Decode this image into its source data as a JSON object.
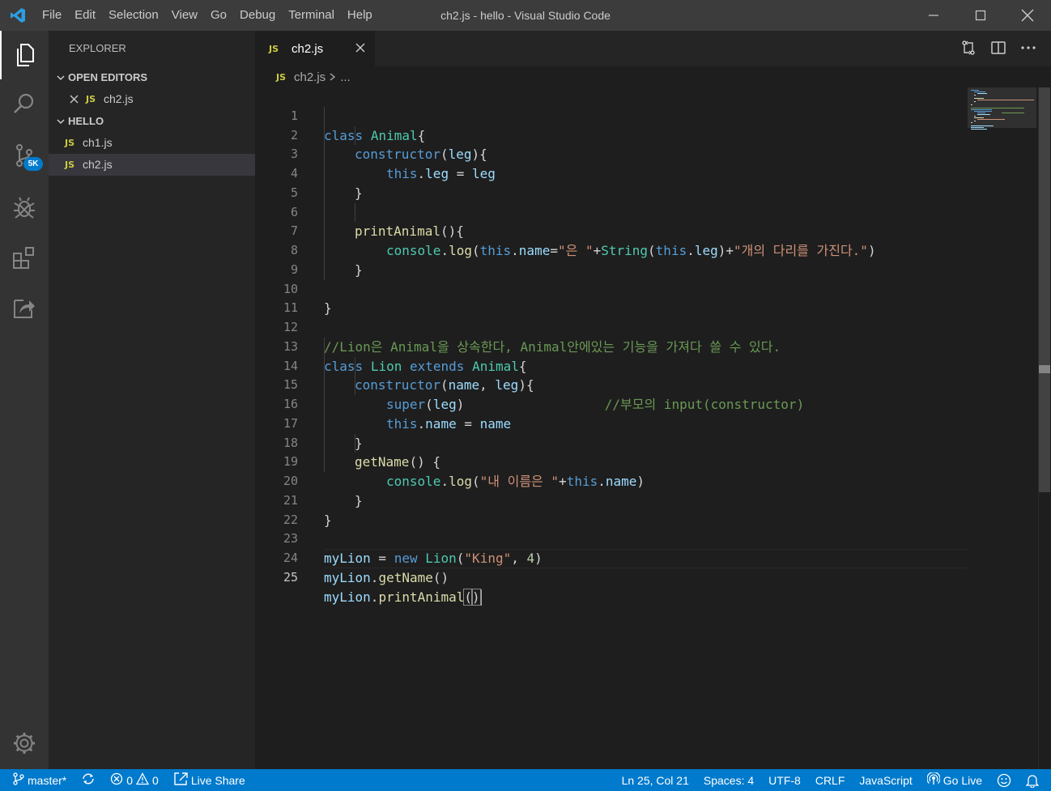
{
  "titlebar": {
    "title": "ch2.js - hello - Visual Studio Code",
    "menu": [
      "File",
      "Edit",
      "Selection",
      "View",
      "Go",
      "Debug",
      "Terminal",
      "Help"
    ]
  },
  "activity": {
    "scm_badge": "5K"
  },
  "sidebar": {
    "title": "EXPLORER",
    "open_editors_label": "OPEN EDITORS",
    "open_editors": [
      {
        "icon": "JS",
        "name": "ch2.js"
      }
    ],
    "folder_label": "HELLO",
    "files": [
      {
        "icon": "JS",
        "name": "ch1.js"
      },
      {
        "icon": "JS",
        "name": "ch2.js"
      }
    ]
  },
  "tabs": [
    {
      "icon": "JS",
      "label": "ch2.js"
    }
  ],
  "breadcrumb": {
    "icon": "JS",
    "file": "ch2.js",
    "more": "..."
  },
  "editor": {
    "line_numbers": [
      "1",
      "2",
      "3",
      "4",
      "5",
      "6",
      "7",
      "8",
      "9",
      "10",
      "11",
      "12",
      "13",
      "14",
      "15",
      "16",
      "17",
      "18",
      "19",
      "20",
      "21",
      "22",
      "23",
      "24",
      "25"
    ],
    "tokens": {
      "l1": [
        "class",
        " ",
        "Animal",
        "{"
      ],
      "l2": [
        "constructor",
        "(",
        "leg",
        "){"
      ],
      "l3": [
        "this",
        ".",
        "leg",
        " = ",
        "leg"
      ],
      "l4": [
        "}"
      ],
      "l6": [
        "printAnimal",
        "(){"
      ],
      "l7": [
        "console",
        ".",
        "log",
        "(",
        "this",
        ".",
        "name",
        "=",
        "\"은 \"",
        "+",
        "String",
        "(",
        "this",
        ".",
        "leg",
        ")+",
        "\"개의 다리를 가진다.\"",
        ")"
      ],
      "l8": [
        "}"
      ],
      "l10": [
        "}"
      ],
      "l12": [
        "//Lion은 Animal을 상속한다, Animal안에있는 기능을 가져다 쓸 수 있다."
      ],
      "l13": [
        "class",
        " ",
        "Lion",
        " ",
        "extends",
        " ",
        "Animal",
        "{"
      ],
      "l14": [
        "constructor",
        "(",
        "name",
        ", ",
        "leg",
        "){"
      ],
      "l15": [
        "super",
        "(",
        "leg",
        ")",
        "                  ",
        "//부모의 input(constructor)"
      ],
      "l16": [
        "this",
        ".",
        "name",
        " = ",
        "name"
      ],
      "l17": [
        "}"
      ],
      "l18": [
        "getName",
        "() {"
      ],
      "l19": [
        "console",
        ".",
        "log",
        "(",
        "\"내 이름은 \"",
        "+",
        "this",
        ".",
        "name",
        ")"
      ],
      "l20": [
        "}"
      ],
      "l21": [
        "}"
      ],
      "l23": [
        "myLion",
        " = ",
        "new",
        " ",
        "Lion",
        "(",
        "\"King\"",
        ", ",
        "4",
        ")"
      ],
      "l24": [
        "myLion",
        ".",
        "getName",
        "()"
      ],
      "l25": [
        "myLion",
        ".",
        "printAnimal",
        "(",
        ")"
      ]
    }
  },
  "statusbar": {
    "branch": "master*",
    "errors": "0",
    "warnings": "0",
    "live_share": "Live Share",
    "position": "Ln 25, Col 21",
    "spaces": "Spaces: 4",
    "encoding": "UTF-8",
    "eol": "CRLF",
    "language": "JavaScript",
    "go_live": "Go Live"
  },
  "colors": {
    "accent": "#007acc",
    "keyword": "#569cd6",
    "class": "#4ec9b0",
    "function": "#dcdcaa",
    "variable": "#9cdcfe",
    "string": "#ce9178",
    "comment": "#6a9955",
    "js_icon": "#cbcb41"
  }
}
